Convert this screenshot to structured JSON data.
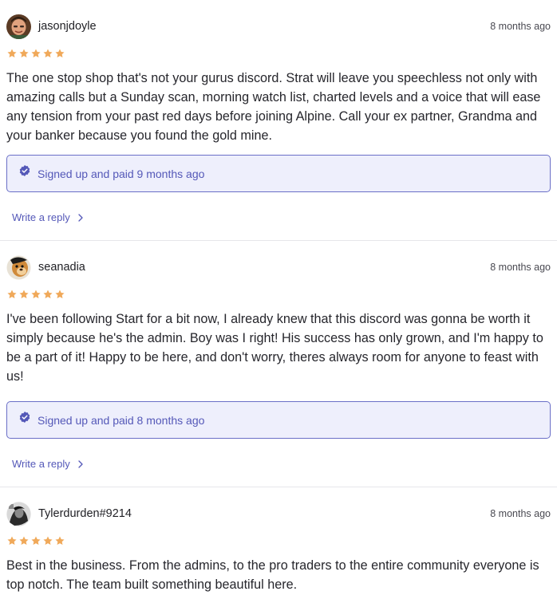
{
  "reviews": [
    {
      "username": "jasonjdoyle",
      "time": "8 months ago",
      "rating": 5,
      "text": "The one stop shop that's not your gurus discord. Strat will leave you speechless not only with amazing calls but a Sunday scan, morning watch list, charted levels and a voice that will ease any tension from your past red days before joining Alpine. Call your ex partner, Grandma and your banker because you found the gold mine.",
      "paid": "Signed up and paid 9 months ago",
      "reply_label": "Write a reply"
    },
    {
      "username": "seanadia",
      "time": "8 months ago",
      "rating": 5,
      "text": "I've been following Start for a bit now, I already knew that this discord was gonna be worth it simply because he's the admin. Boy was I right! His success has only grown, and I'm happy to be a part of it! Happy to be here, and don't worry, theres always room for anyone to feast with us!",
      "paid": "Signed up and paid 8 months ago",
      "reply_label": "Write a reply"
    },
    {
      "username": "Tylerdurden#9214",
      "time": "8 months ago",
      "rating": 5,
      "text": "Best in the business. From the admins, to the pro traders to the entire community everyone is top notch. The team built something beautiful here."
    }
  ],
  "icons": {
    "star": "star-icon",
    "verified": "verified-check-icon",
    "chevron": "chevron-right-icon"
  },
  "colors": {
    "star": "#f0a95a",
    "accent": "#5458b8",
    "paid_bg": "#eeeffc",
    "paid_border": "#6a6fc7"
  }
}
